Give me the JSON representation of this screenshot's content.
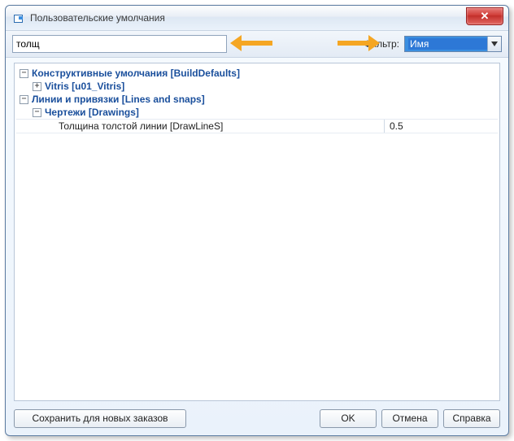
{
  "window": {
    "title": "Пользовательские умолчания"
  },
  "filterbar": {
    "search_value": "толщ",
    "filter_label": "Фильтр:",
    "filter_selected": "Имя"
  },
  "tree": {
    "build_defaults": {
      "label": "Конструктивные умолчания [BuildDefaults]",
      "expanded": true,
      "children": {
        "vitris": {
          "label": "Vitris [u01_Vitris]",
          "expanded": false
        }
      }
    },
    "lines_snaps": {
      "label": "Линии и привязки [Lines and snaps]",
      "expanded": true,
      "children": {
        "drawings": {
          "label": "Чертежи [Drawings]",
          "expanded": true,
          "items": [
            {
              "name": "Толщина толстой линии [DrawLineS]",
              "value": "0.5"
            }
          ]
        }
      }
    }
  },
  "buttons": {
    "save": "Сохранить для новых заказов",
    "ok": "OK",
    "cancel": "Отмена",
    "help": "Справка"
  },
  "annotations": {
    "arrow_to_search": true,
    "arrow_to_filter": true
  }
}
